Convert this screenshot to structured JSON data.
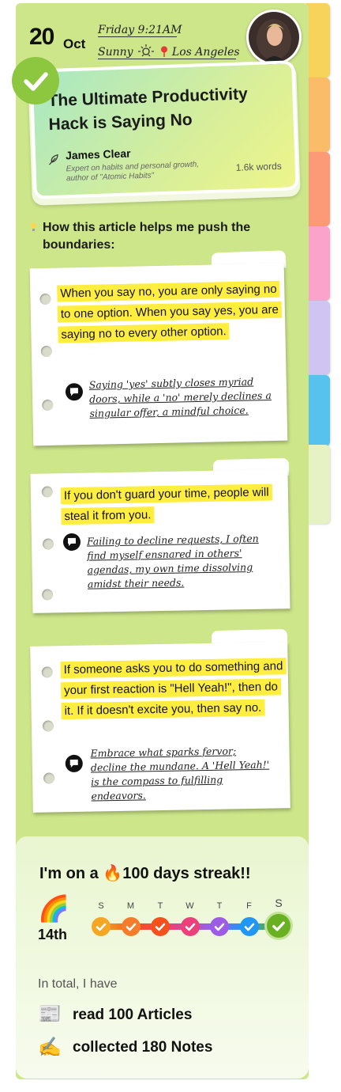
{
  "header": {
    "day_number": "20",
    "month": "Oct",
    "day_time": "Friday  9:21AM",
    "weather": "Sunny",
    "location": "Los Angeles"
  },
  "article": {
    "title": "The Ultimate Productivity Hack is Saying No",
    "author": "James Clear",
    "author_bio": "Expert on habits and personal growth, author of \"Atomic Habits\"",
    "word_count": "1.6k words"
  },
  "section_heading": "How this article helps me push the boundaries:",
  "notes": [
    {
      "quote": "When you say no, you are only saying no to one option. When you say yes, you are saying no to every other option.",
      "comment": "Saying 'yes' subtly closes myriad doors, while a 'no' merely declines a singular offer, a mindful choice."
    },
    {
      "quote": "If you don't guard your time, people will steal it from you.",
      "comment": "Failing to decline requests, I often find myself ensnared in others' agendas, my own time dissolving amidst their needs."
    },
    {
      "quote": "If someone asks you to do something and your first reaction is \"Hell Yeah!\", then do it. If it doesn't excite you, then say no.",
      "comment": "Embrace what sparks fervor; decline the mundane. A 'Hell Yeah!' is the compass to fulfilling endeavors."
    }
  ],
  "streak": {
    "prefix": "I'm on a",
    "fire": "🔥",
    "suffix": "100 days streak!!",
    "rainbow": "🌈",
    "rank": "14th",
    "days": [
      "S",
      "M",
      "T",
      "W",
      "T",
      "F",
      "S"
    ],
    "day_colors": [
      "#f5a623",
      "#f57c2a",
      "#f4511e",
      "#ec407a",
      "#9c5ce6",
      "#2196f3",
      "#6ab023"
    ],
    "total_label": "In total, I have",
    "stats": [
      {
        "emoji": "📰",
        "text": "read 100 Articles"
      },
      {
        "emoji": "✍",
        "text": "collected 180 Notes"
      }
    ]
  },
  "side_tabs": [
    "#f7d35a",
    "#fbbc6a",
    "#fc9a78",
    "#fba3cb",
    "#cfc4f2",
    "#58c2ef",
    "#e6f2c3"
  ]
}
